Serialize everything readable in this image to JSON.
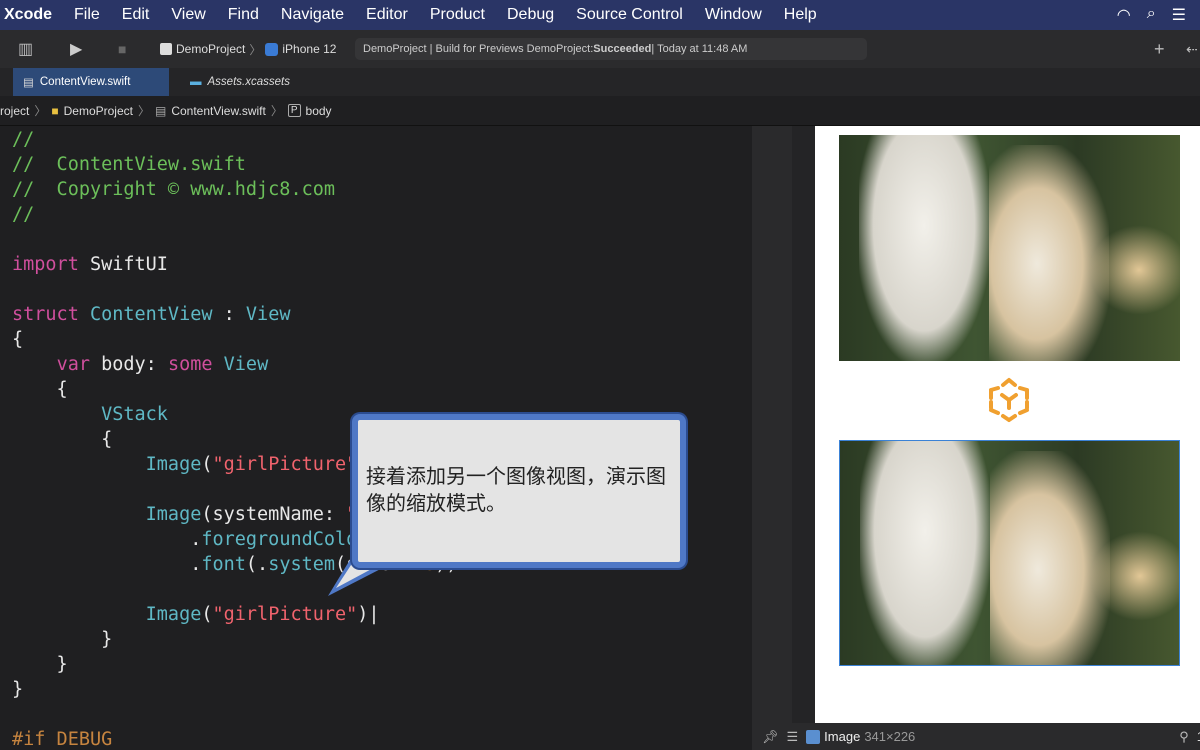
{
  "menubar": {
    "app": "Xcode",
    "items": [
      "File",
      "Edit",
      "View",
      "Find",
      "Navigate",
      "Editor",
      "Product",
      "Debug",
      "Source Control",
      "Window",
      "Help"
    ]
  },
  "toolbar": {
    "scheme": "DemoProject",
    "device": "iPhone 12",
    "status_prefix": "DemoProject | Build for Previews DemoProject: ",
    "status_result": "Succeeded",
    "status_time": " | Today at 11:48 AM"
  },
  "tabs": [
    {
      "label": "ContentView.swift",
      "active": true
    },
    {
      "label": "Assets.xcassets",
      "active": false
    }
  ],
  "breadcrumb": [
    "roject",
    "DemoProject",
    "ContentView.swift",
    "body"
  ],
  "code": [
    [
      [
        "//",
        "cm"
      ]
    ],
    [
      [
        "//  ContentView.swift",
        "cm"
      ]
    ],
    [
      [
        "//  Copyright © www.hdjc8.com",
        "cm"
      ]
    ],
    [
      [
        "//",
        "cm"
      ]
    ],
    [],
    [
      [
        "import",
        "kw"
      ],
      [
        " SwiftUI",
        ""
      ]
    ],
    [],
    [
      [
        "struct",
        "kw"
      ],
      [
        " ",
        ""
      ],
      [
        "ContentView",
        "ty"
      ],
      [
        " : ",
        ""
      ],
      [
        "View",
        "ty"
      ]
    ],
    [
      [
        "{",
        ""
      ]
    ],
    [
      [
        "    ",
        ""
      ],
      [
        "var",
        "kw"
      ],
      [
        " body: ",
        ""
      ],
      [
        "some",
        "kw"
      ],
      [
        " ",
        ""
      ],
      [
        "View",
        "ty"
      ]
    ],
    [
      [
        "    {",
        ""
      ]
    ],
    [
      [
        "        ",
        ""
      ],
      [
        "VStack",
        "fn"
      ]
    ],
    [
      [
        "        {",
        ""
      ]
    ],
    [
      [
        "            ",
        ""
      ],
      [
        "Image",
        "fn"
      ],
      [
        "(",
        ""
      ],
      [
        "\"girlPicture\"",
        "st"
      ],
      [
        ")",
        ""
      ]
    ],
    [],
    [
      [
        "            ",
        ""
      ],
      [
        "Image",
        "fn"
      ],
      [
        "(systemName: ",
        ""
      ],
      [
        "\"gift\"",
        "st"
      ],
      [
        ")",
        ""
      ]
    ],
    [
      [
        "                .",
        ""
      ],
      [
        "foregroundColor",
        "fn"
      ],
      [
        "(.",
        ""
      ],
      [
        "orange",
        "fn"
      ],
      [
        ")",
        ""
      ]
    ],
    [
      [
        "                .",
        ""
      ],
      [
        "font",
        "fn"
      ],
      [
        "(.",
        ""
      ],
      [
        "system",
        "fn"
      ],
      [
        "(size: ",
        ""
      ],
      [
        "48",
        "pp"
      ],
      [
        "))",
        ""
      ]
    ],
    [],
    [
      [
        "            ",
        ""
      ],
      [
        "Image",
        "fn"
      ],
      [
        "(",
        ""
      ],
      [
        "\"girlPicture\"",
        "st"
      ],
      [
        ")|",
        ""
      ]
    ],
    [
      [
        "        }",
        ""
      ]
    ],
    [
      [
        "    }",
        ""
      ]
    ],
    [
      [
        "}",
        ""
      ]
    ],
    [],
    [
      [
        "#if DEBUG",
        "pp"
      ]
    ]
  ],
  "callout": {
    "text": "接着添加另一个图像视图，演示图像的缩放模式。"
  },
  "preview": {
    "images": [
      "girlPicture",
      "girlPicture"
    ],
    "gift_color": "#f0a030"
  },
  "bottombar": {
    "selection": "Image",
    "size": "341×226",
    "zoom": "1"
  }
}
